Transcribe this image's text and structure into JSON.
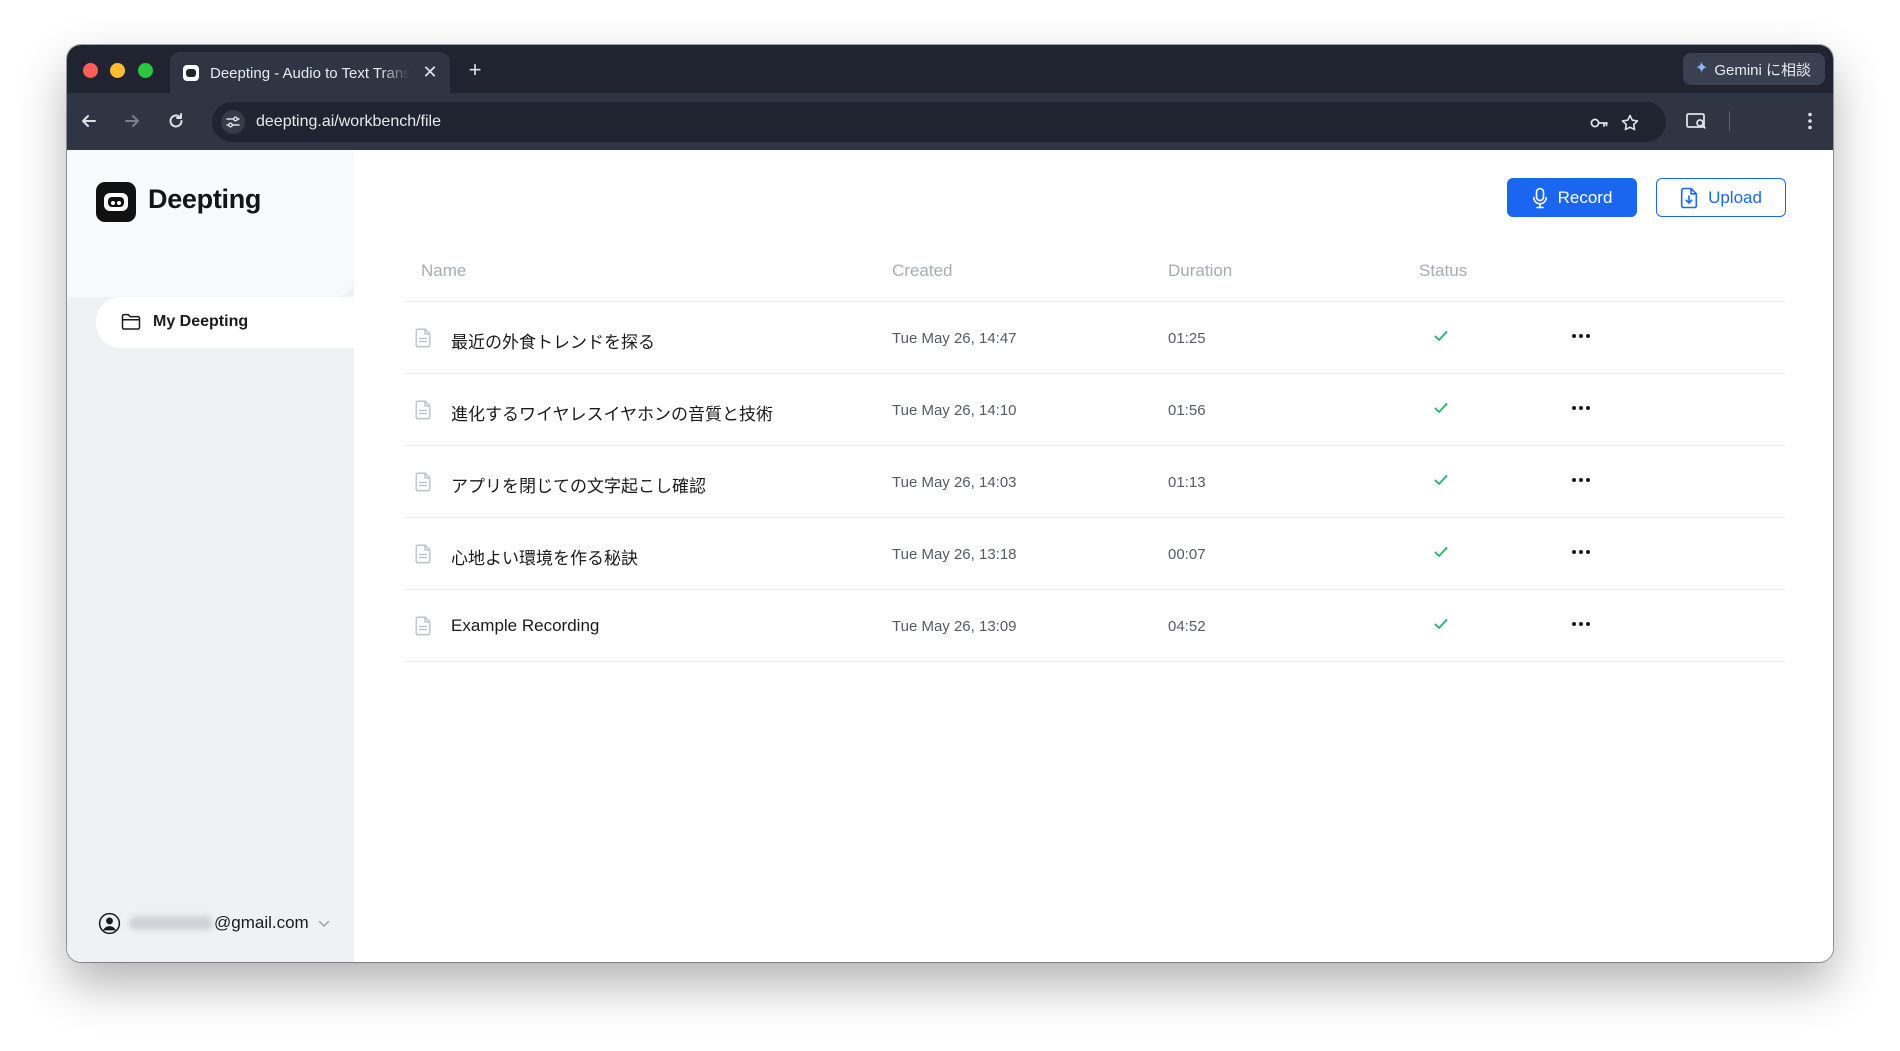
{
  "browser": {
    "tab_title": "Deepting - Audio to Text Transcription",
    "tab_close": "✕",
    "new_tab": "+",
    "gemini_label": "Gemini に相談",
    "url": "deepting.ai/workbench/file"
  },
  "sidebar": {
    "brand": "Deepting",
    "nav_items": [
      {
        "label": "My Deepting",
        "icon": "folder-icon",
        "active": true
      }
    ],
    "account_domain": "@gmail.com"
  },
  "actions": {
    "record_label": "Record",
    "upload_label": "Upload",
    "primary_color": "#1a66f0"
  },
  "table": {
    "columns": [
      "Name",
      "Created",
      "Duration",
      "Status"
    ],
    "rows": [
      {
        "name": "最近の外食トレンドを探る",
        "created": "Tue May 26, 14:47",
        "duration": "01:25",
        "status": "done"
      },
      {
        "name": "進化するワイヤレスイヤホンの音質と技術",
        "created": "Tue May 26, 14:10",
        "duration": "01:56",
        "status": "done"
      },
      {
        "name": "アプリを閉じての文字起こし確認",
        "created": "Tue May 26, 14:03",
        "duration": "01:13",
        "status": "done"
      },
      {
        "name": "心地よい環境を作る秘訣",
        "created": "Tue May 26, 13:18",
        "duration": "00:07",
        "status": "done"
      },
      {
        "name": "Example Recording",
        "created": "Tue May 26, 13:09",
        "duration": "04:52",
        "status": "done"
      }
    ]
  },
  "colors": {
    "status_done": "#27b36a",
    "window_chrome": "#1f2430"
  }
}
